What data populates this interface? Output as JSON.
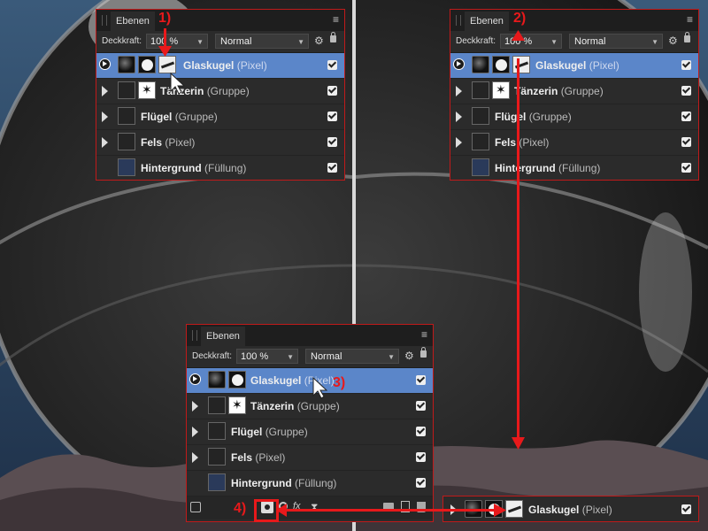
{
  "panel": {
    "tab": "Ebenen",
    "opacity_label": "Deckkraft:",
    "opacity_value": "100 %",
    "blend_mode": "Normal"
  },
  "layers": [
    {
      "name": "Glaskugel",
      "type": "(Pixel)"
    },
    {
      "name": "Tänzerin",
      "type": "(Gruppe)"
    },
    {
      "name": "Flügel",
      "type": "(Gruppe)"
    },
    {
      "name": "Fels",
      "type": "(Pixel)"
    },
    {
      "name": "Hintergrund",
      "type": "(Füllung)"
    }
  ],
  "callouts": {
    "step1": "1)",
    "step2": "2)",
    "step3": "3)",
    "step4": "4)"
  },
  "colors": {
    "accent_red": "#e8191b",
    "selection": "#5b86c9",
    "panel_bg": "#2b2b2b"
  }
}
